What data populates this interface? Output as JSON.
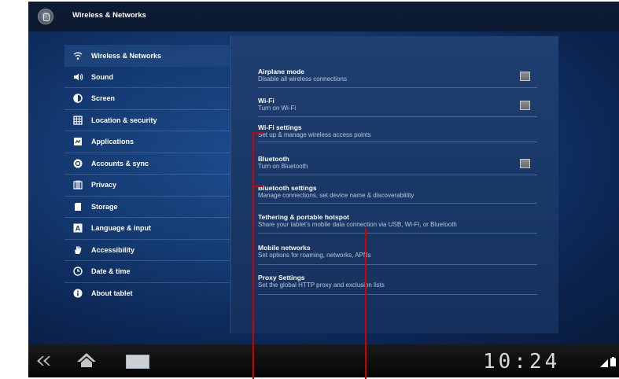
{
  "title_bar": {
    "title": "Wireless & Networks",
    "app_icon": "settings-icon"
  },
  "left_menu": {
    "items": [
      {
        "label": "Wireless & Networks",
        "icon": "wifi-icon",
        "selected": true
      },
      {
        "label": "Sound",
        "icon": "speaker-icon"
      },
      {
        "label": "Screen",
        "icon": "brightness-icon"
      },
      {
        "label": "Location & security",
        "icon": "location-grid-icon"
      },
      {
        "label": "Applications",
        "icon": "applications-icon"
      },
      {
        "label": "Accounts & sync",
        "icon": "sync-icon"
      },
      {
        "label": "Privacy",
        "icon": "privacy-icon"
      },
      {
        "label": "Storage",
        "icon": "sd-card-icon"
      },
      {
        "label": "Language & input",
        "icon": "keyboard-a-icon"
      },
      {
        "label": "Accessibility",
        "icon": "hand-icon"
      },
      {
        "label": "Date & time",
        "icon": "clock-icon"
      },
      {
        "label": "About tablet",
        "icon": "info-icon"
      }
    ]
  },
  "settings": [
    {
      "title": "Airplane mode",
      "summary": "Disable all wireless connections",
      "checkbox": true
    },
    {
      "title": "Wi-Fi",
      "summary": "Turn on Wi-Fi",
      "checkbox": true
    },
    {
      "title": "Wi-Fi settings",
      "summary": "Set up & manage wireless access points",
      "checkbox": false
    },
    {
      "title": "Bluetooth",
      "summary": "Turn on Bluetooth",
      "checkbox": true
    },
    {
      "title": "Bluetooth settings",
      "summary": "Manage connections, set device name & discoverablility",
      "checkbox": false
    },
    {
      "title": "Tethering & portable hotspot",
      "summary": "Share your tablet’s mobile data connection via USB, Wi-Fi, or Bluetooth",
      "checkbox": false
    },
    {
      "title": "Mobile networks",
      "summary": "Set options for roaming, networks, APNs",
      "checkbox": false
    },
    {
      "title": "Proxy Settings",
      "summary": "Set the global HTTP proxy and exclusion lists",
      "checkbox": false
    }
  ],
  "nav_bar": {
    "clock": "10:24",
    "buttons": [
      "back-icon",
      "home-icon",
      "recent-apps-icon"
    ],
    "status_icons": [
      "signal-icon",
      "battery-icon"
    ]
  },
  "colors": {
    "callout": "#d00000",
    "selected_row": "#20467d",
    "background": "#143a72"
  }
}
